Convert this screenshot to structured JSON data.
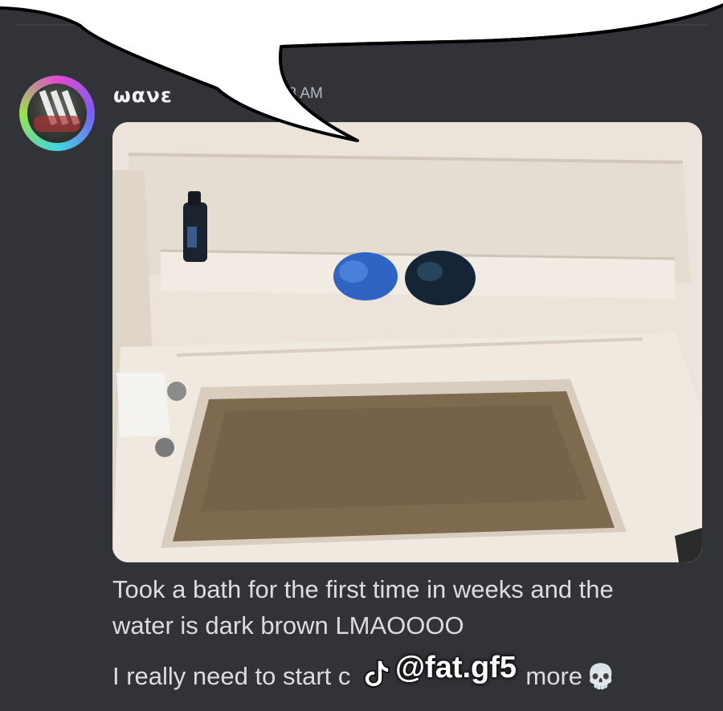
{
  "message": {
    "username": "ωανε",
    "timestamp": "58 AM",
    "lines": [
      "Took a bath for the first time in weeks and the",
      "water is dark brown LMAOOOO",
      "I really need to start c"
    ],
    "line3_tail": "more",
    "line3_emoji": "💀"
  },
  "watermark": {
    "handle": "@fat.gf5",
    "icon": "tiktok-icon"
  },
  "colors": {
    "background": "#313338",
    "text": "#dcdde0",
    "bathwater": "#7d6a4f"
  }
}
